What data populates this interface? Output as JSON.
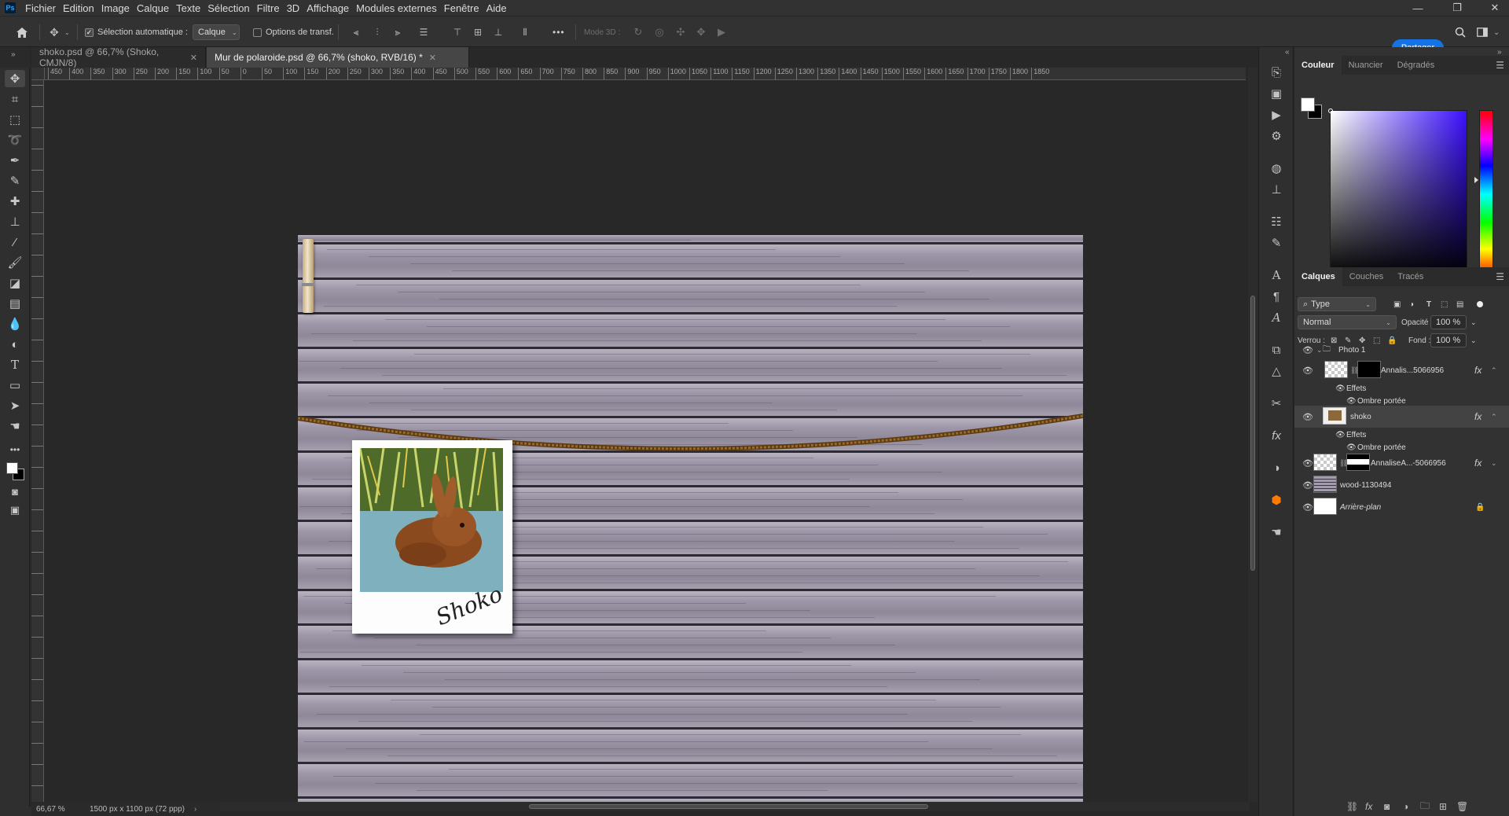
{
  "app": {
    "logo": "Ps"
  },
  "menu": [
    "Fichier",
    "Edition",
    "Image",
    "Calque",
    "Texte",
    "Sélection",
    "Filtre",
    "3D",
    "Affichage",
    "Modules externes",
    "Fenêtre",
    "Aide"
  ],
  "window_controls": {
    "minimize": "—",
    "restore": "❐",
    "close": "✕"
  },
  "options": {
    "auto_select_label": "Sélection automatique :",
    "auto_select_checked": true,
    "layer_select_value": "Calque",
    "transform_options_label": "Options de transf.",
    "mode3d_label": "Mode 3D :",
    "more": "•••",
    "share_label": "Partager"
  },
  "tabs": [
    {
      "label": "shoko.psd @ 66,7% (Shoko, CMJN/8)",
      "active": false
    },
    {
      "label": "Mur de polaroide.psd @ 66,7% (shoko, RVB/16) *",
      "active": true
    }
  ],
  "ruler": {
    "h_labels": [
      "450",
      "400",
      "350",
      "300",
      "250",
      "200",
      "150",
      "100",
      "50",
      "0",
      "50",
      "100",
      "150",
      "200",
      "250",
      "300",
      "350",
      "400",
      "450",
      "500",
      "550",
      "600",
      "650",
      "700",
      "750",
      "800",
      "850",
      "900",
      "950",
      "1000",
      "1050",
      "1100",
      "1150",
      "1200",
      "1250",
      "1300",
      "1350",
      "1400",
      "1450",
      "1500",
      "1550",
      "1600",
      "1650",
      "1700",
      "1750",
      "1800",
      "1850"
    ]
  },
  "canvas": {
    "signature": "Shoko"
  },
  "status": {
    "zoom": "66,67 %",
    "doc_size": "1500 px x 1100 px (72 ppp)"
  },
  "color_panel": {
    "tabs": [
      "Couleur",
      "Nuancier",
      "Dégradés"
    ],
    "active": "Couleur",
    "foreground": "#ffffff",
    "background": "#000000"
  },
  "layers_panel": {
    "tabs": [
      "Calques",
      "Couches",
      "Tracés"
    ],
    "active": "Calques",
    "filter_value": "Type",
    "blend_mode": "Normal",
    "opacity_label": "Opacité :",
    "opacity_value": "100 %",
    "lock_label": "Verrou :",
    "fill_label": "Fond :",
    "fill_value": "100 %",
    "layers": [
      {
        "name": "Photo 1",
        "type": "group"
      },
      {
        "name": "Annalis...5066956",
        "type": "masked",
        "fx": "fx"
      },
      {
        "name": "Effets",
        "type": "effects-header"
      },
      {
        "name": "Ombre portée",
        "type": "effect"
      },
      {
        "name": "shoko",
        "type": "image",
        "fx": "fx",
        "selected": true
      },
      {
        "name": "Effets",
        "type": "effects-header"
      },
      {
        "name": "Ombre portée",
        "type": "effect"
      },
      {
        "name": "AnnaliseA...-5066956",
        "type": "masked",
        "fx": "fx"
      },
      {
        "name": "wood-1130494",
        "type": "image"
      },
      {
        "name": "Arrière-plan",
        "type": "background",
        "locked": true
      }
    ]
  }
}
